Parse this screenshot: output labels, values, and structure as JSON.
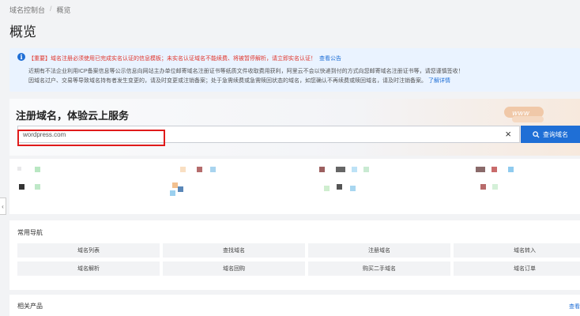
{
  "breadcrumb": {
    "root": "域名控制台",
    "separator": "/",
    "current": "概览"
  },
  "page": {
    "title": "概览"
  },
  "notice": {
    "info_symbol": "i",
    "line1_warning": "【重要】域名注册必须使用已完成实名认证的信息模板；未实名认证域名不能续费、将被暂停解析，请立即实名认证！",
    "line1_link": "查看公告",
    "line2": "近期有不法企业利用ICP备案信息等公示信息向网站主办单位邮寄域名注册证书等纸质文件收取费用获利，阿里云不会以快递到付的方式向您邮寄域名注册证书等，请您谨慎签收！",
    "line3": "因域名过户、交易等导致域名持有者发生变更的，请及时变更或注销备案；处于急需续费或急需赎回状态的域名，如您确认不再续费或赎回域名，请及时注销备案。",
    "line3_link": "了解详情"
  },
  "register": {
    "title": "注册域名，体验云上服务",
    "search_value": "wordpress.com",
    "clear_symbol": "×",
    "search_button": "查询域名"
  },
  "collapse_symbol": "‹",
  "quick_nav": {
    "title": "常用导航",
    "items": [
      "域名列表",
      "查找域名",
      "注册域名",
      "域名转入",
      "域名解析",
      "域名回购",
      "购买二手域名",
      "域名订单"
    ]
  },
  "related": {
    "title": "相关产品",
    "link": "查看"
  },
  "colors": {
    "accent": "#1f6fd6",
    "highlight": "#e01b1b",
    "warning": "#e0342b"
  }
}
